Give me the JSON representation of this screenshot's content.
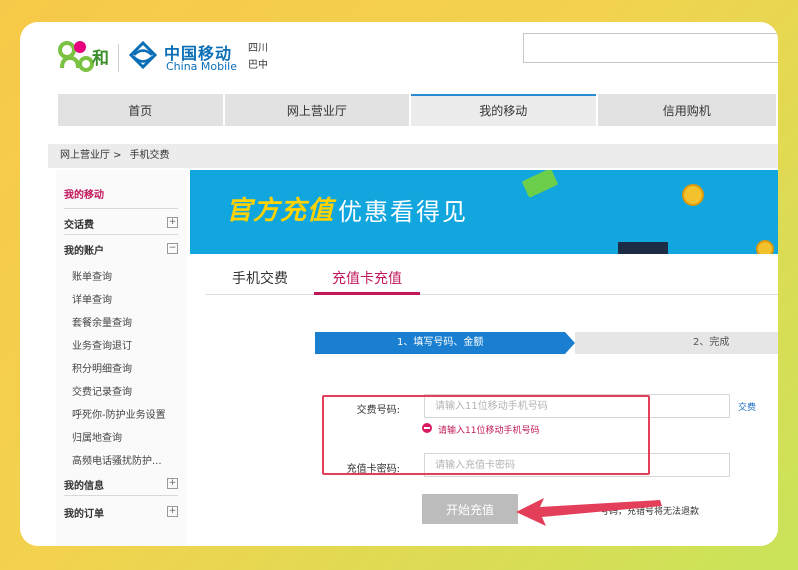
{
  "header": {
    "brand_he": "和",
    "cm_cn": "中国移动",
    "cm_en": "China Mobile",
    "region_line1": "四川",
    "region_line2": "巴中"
  },
  "nav": {
    "items": [
      "首页",
      "网上营业厅",
      "我的移动",
      "信用购机"
    ],
    "active": "我的移动"
  },
  "breadcrumb": {
    "item1": "网上营业厅 >",
    "item2": "手机交费"
  },
  "sidebar": {
    "title": "我的移动",
    "sections": [
      {
        "label": "交话费",
        "toggle": "+"
      },
      {
        "label": "我的账户",
        "toggle": "−"
      }
    ],
    "sub_items": [
      "账单查询",
      "详单查询",
      "套餐余量查询",
      "业务查询退订",
      "积分明细查询",
      "交费记录查询",
      "呼死你-防护业务设置",
      "归属地查询",
      "高频电话骚扰防护..."
    ],
    "bottom_sections": [
      {
        "label": "我的信息",
        "toggle": "+"
      },
      {
        "label": "我的订单",
        "toggle": "+"
      }
    ]
  },
  "banner": {
    "title": "官方充值",
    "subtitle": "优惠看得见"
  },
  "tabs": {
    "tab1": "手机交费",
    "tab2": "充值卡充值",
    "active": "充值卡充值"
  },
  "steps": {
    "step1": "1、填写号码、金额",
    "step2": "2、完成"
  },
  "form": {
    "phone_label": "交费号码:",
    "phone_placeholder": "请输入11位移动手机号码",
    "phone_error": "请输入11位移动手机号码",
    "card_label": "充值卡密码:",
    "card_placeholder": "请输入充值卡密码",
    "submit_label": "开始充值",
    "side_link": "交费",
    "note": "号码，充错号将无法退款"
  },
  "colors": {
    "accent_pink": "#c2185b",
    "step_blue": "#1a7fd0",
    "banner_blue": "#12a6df",
    "banner_yellow": "#ffd200",
    "annotation_red": "#e43f5a"
  }
}
